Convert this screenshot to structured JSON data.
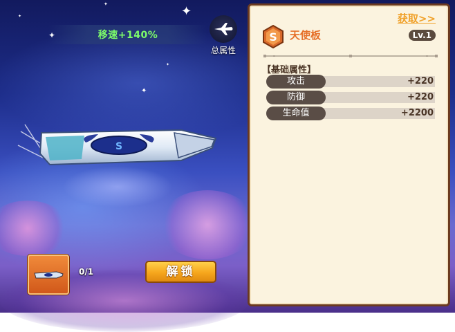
{
  "buff": {
    "speed_text": "移速+140%"
  },
  "total_attributes": {
    "label": "总属性",
    "icon": "airplane-icon"
  },
  "inventory": {
    "count_text": "0/1",
    "unlock_label": "解锁"
  },
  "panel": {
    "get_link": "获取>>",
    "rank": "S",
    "item_name": "天使板",
    "level": "Lv.1",
    "section_title": "【基础属性】",
    "stats": [
      {
        "label": "攻击",
        "value": "+220"
      },
      {
        "label": "防御",
        "value": "+220"
      },
      {
        "label": "生命值",
        "value": "+2200"
      }
    ]
  },
  "colors": {
    "speed_green": "#7dfc6a",
    "accent_orange": "#e6702a",
    "panel_border": "#6b3a20",
    "button_gold": "#f6a61c"
  }
}
